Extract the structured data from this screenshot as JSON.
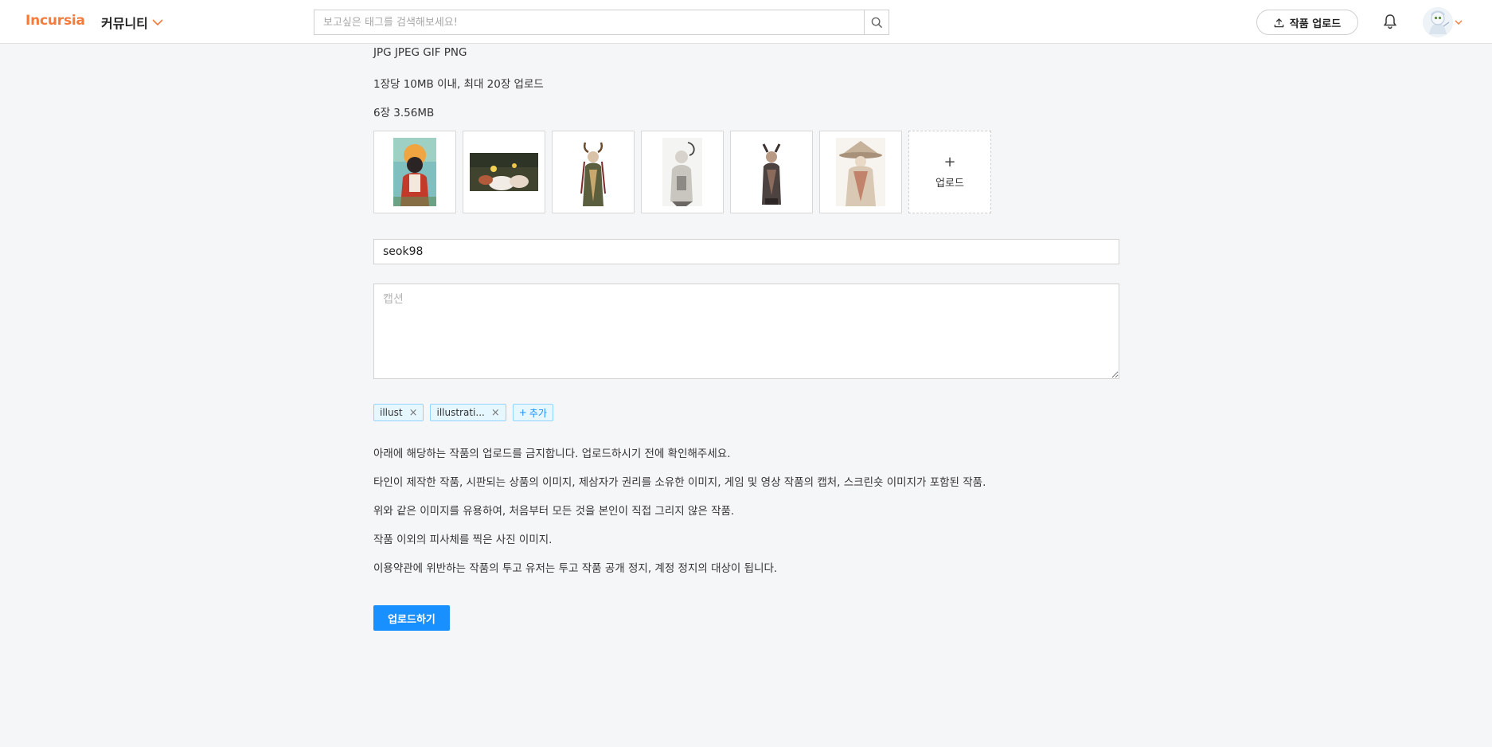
{
  "header": {
    "logo": "Incursia",
    "community_label": "커뮤니티",
    "search_placeholder": "보고싶은 태그를 검색해보세요!",
    "upload_label": "작품 업로드",
    "accent_color": "#f47b3c"
  },
  "upload": {
    "formats": "JPG JPEG GIF PNG",
    "limit": "1장당 10MB 이내, 최대 20장 업로드",
    "status": "6장 3.56MB",
    "add_label": "업로드",
    "thumbnails": [
      "image-1",
      "image-2",
      "image-3",
      "image-4",
      "image-5",
      "image-6"
    ]
  },
  "form": {
    "title_value": "seok98",
    "caption_placeholder": "캡션",
    "tags": [
      "illust",
      "illustrati..."
    ],
    "add_tag_label": "추가",
    "tag_color": "#1890ff"
  },
  "notice": [
    "아래에 해당하는 작품의 업로드를 금지합니다. 업로드하시기 전에 확인해주세요.",
    "타인이 제작한 작품, 시판되는 상품의 이미지, 제삼자가 권리를 소유한 이미지, 게임 및 영상 작품의 캡처, 스크린숏 이미지가 포함된 작품.",
    "위와 같은 이미지를 유용하여, 처음부터 모든 것을 본인이 직접 그리지 않은 작품.",
    "작품 이외의 피사체를 찍은 사진 이미지.",
    "이용약관에 위반하는 작품의 투고 유저는 투고 작품 공개 정지, 계정 정지의 대상이 됩니다."
  ],
  "submit_label": "업로드하기"
}
